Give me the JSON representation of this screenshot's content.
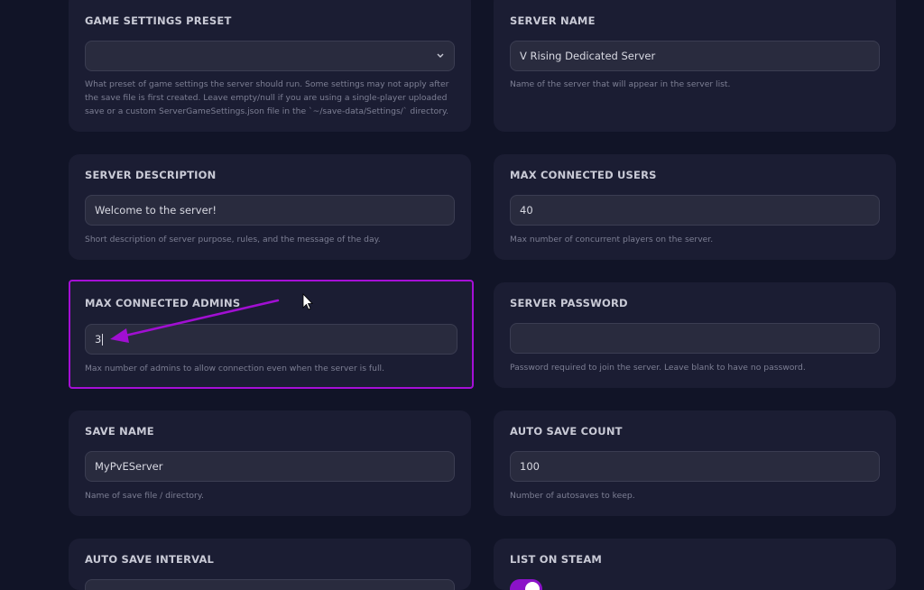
{
  "cards": {
    "game_settings_preset": {
      "label": "GAME SETTINGS PRESET",
      "value": "",
      "help": "What preset of game settings the server should run. Some settings may not apply after the save file is first created. Leave empty/null if you are using a single-player uploaded save or a custom ServerGameSettings.json file in the `~/save-data/Settings/` directory.",
      "icon": "chevron-down-icon"
    },
    "server_name": {
      "label": "SERVER NAME",
      "value": "V Rising Dedicated Server",
      "help": "Name of the server that will appear in the server list."
    },
    "server_description": {
      "label": "SERVER DESCRIPTION",
      "value": "Welcome to the server!",
      "help": "Short description of server purpose, rules, and the message of the day."
    },
    "max_connected_users": {
      "label": "MAX CONNECTED USERS",
      "value": "40",
      "help": "Max number of concurrent players on the server."
    },
    "max_connected_admins": {
      "label": "MAX CONNECTED ADMINS",
      "value": "3",
      "help": "Max number of admins to allow connection even when the server is full."
    },
    "server_password": {
      "label": "SERVER PASSWORD",
      "value": "",
      "help": "Password required to join the server. Leave blank to have no password."
    },
    "save_name": {
      "label": "SAVE NAME",
      "value": "MyPvEServer",
      "help": "Name of save file / directory."
    },
    "auto_save_count": {
      "label": "AUTO SAVE COUNT",
      "value": "100",
      "help": "Number of autosaves to keep."
    },
    "auto_save_interval": {
      "label": "AUTO SAVE INTERVAL"
    },
    "list_on_steam": {
      "label": "LIST ON STEAM",
      "enabled": true
    }
  },
  "colors": {
    "background": "#111427",
    "card": "#1b1d33",
    "highlight": "#a50fd6",
    "toggle_on": "#8b12c9"
  }
}
